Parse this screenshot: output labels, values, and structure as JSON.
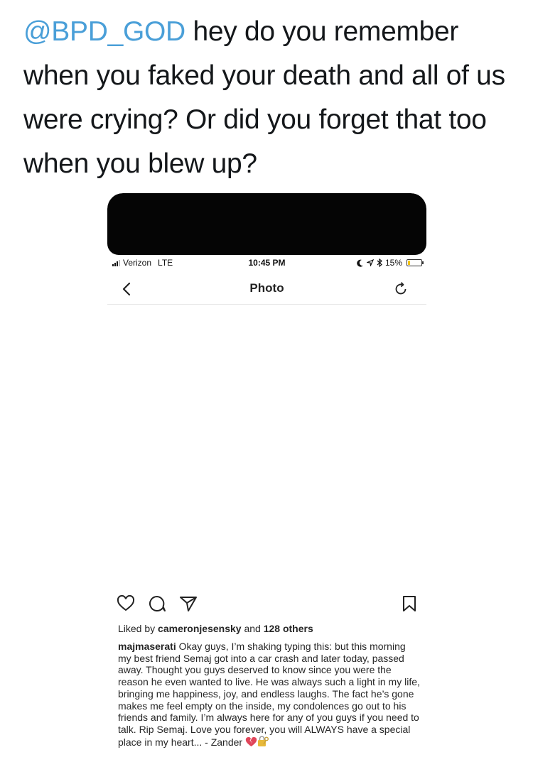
{
  "tweet": {
    "mention": "@BPD_GOD",
    "text": "hey do you remember when you faked your death and all of us were crying? Or did you forget that too when you blew up?",
    "mention_color": "#4a9fd8"
  },
  "status_bar": {
    "carrier": "Verizon",
    "network": "LTE",
    "time": "10:45 PM",
    "battery": "15%",
    "battery_level": 0.15
  },
  "nav": {
    "title": "Photo",
    "back_icon": "chevron-left-icon",
    "refresh_icon": "refresh-icon"
  },
  "actions": {
    "like_icon": "heart-icon",
    "comment_icon": "comment-icon",
    "share_icon": "send-icon",
    "save_icon": "bookmark-icon"
  },
  "likes": {
    "prefix": "Liked by",
    "user": "cameronjesensky",
    "connector": "and",
    "others": "128 others"
  },
  "caption": {
    "username": "majmaserati",
    "text": "Okay guys, I’m shaking typing this: but this morning my best friend Semaj got into a car crash and later today, passed away. Thought you guys deserved to know since you were the reason he even wanted to live. He was always such a light in my life, bringing me happiness, joy, and endless laughs. The fact he’s gone makes me feel empty on the inside, my condolences go out to his friends and family. I’m always here for any of you guys if you need to talk. Rip Semaj. Love you forever, you will ALWAYS have a special place in my heart... - Zander",
    "emojis": [
      "broken-heart-icon",
      "lock-with-key-icon"
    ]
  }
}
